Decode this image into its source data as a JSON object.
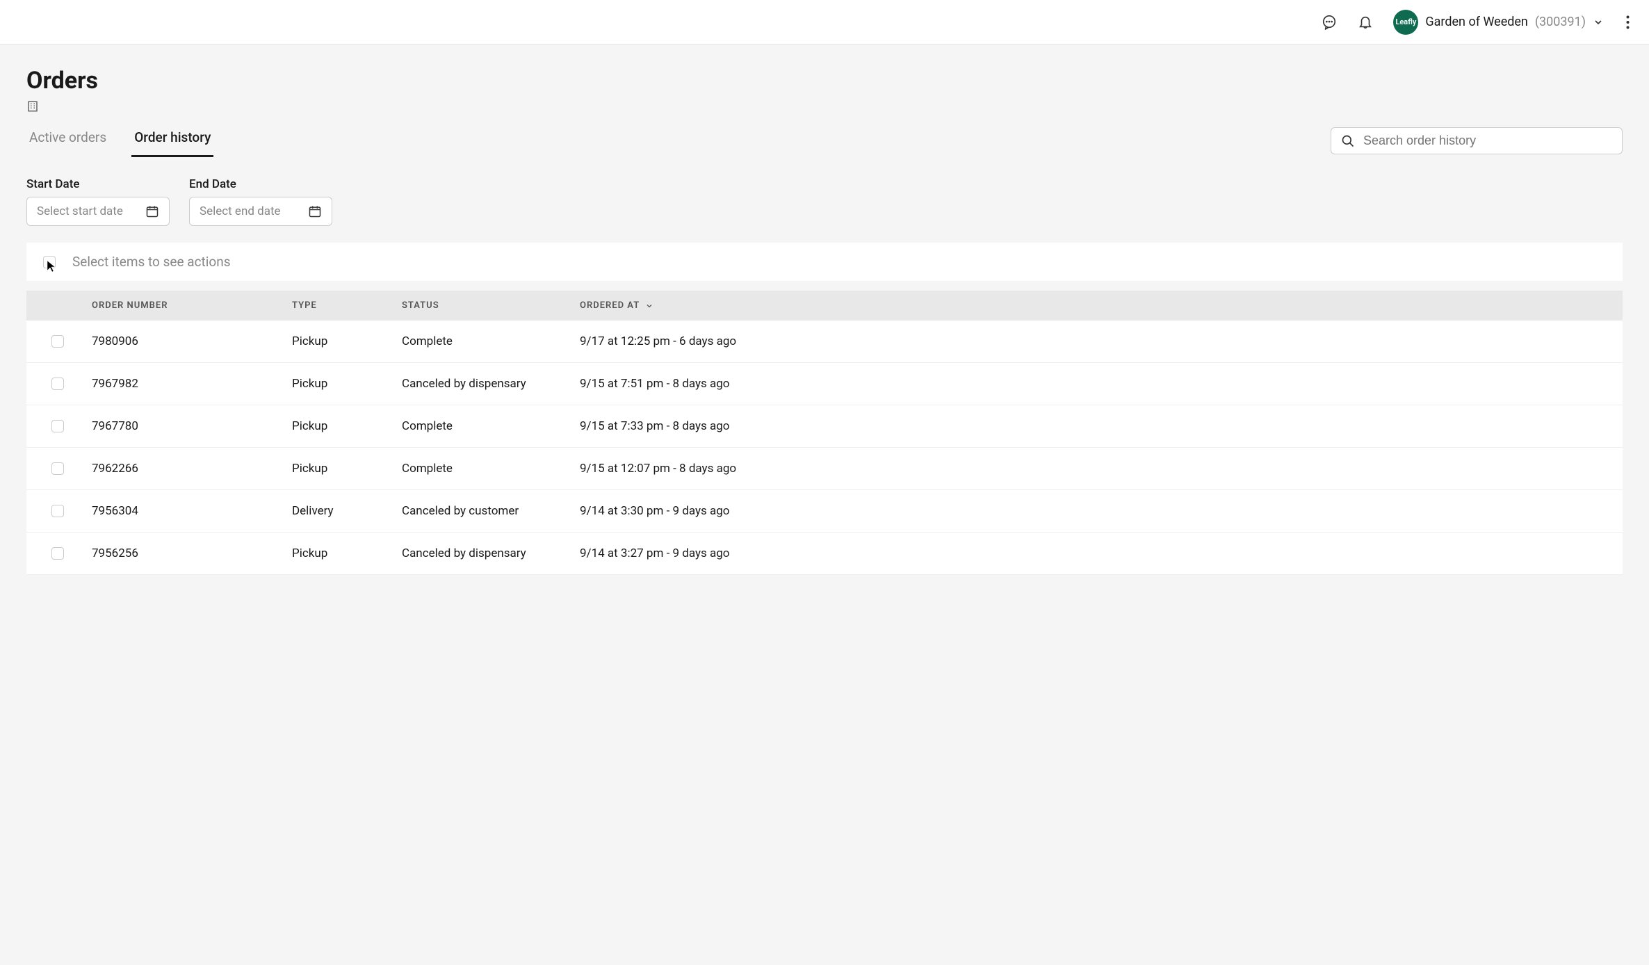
{
  "header": {
    "account_name": "Garden of Weeden",
    "account_id": "(300391)",
    "avatar_text": "Leafly"
  },
  "page": {
    "title": "Orders"
  },
  "tabs": {
    "active_orders": "Active orders",
    "order_history": "Order history"
  },
  "search": {
    "placeholder": "Search order history"
  },
  "filters": {
    "start_date_label": "Start Date",
    "start_date_placeholder": "Select start date",
    "end_date_label": "End Date",
    "end_date_placeholder": "Select end date"
  },
  "actions": {
    "hint": "Select items to see actions"
  },
  "columns": {
    "order_number": "ORDER NUMBER",
    "type": "TYPE",
    "status": "STATUS",
    "ordered_at": "ORDERED AT"
  },
  "rows": [
    {
      "order": "7980906",
      "type": "Pickup",
      "status": "Complete",
      "ordered_at": "9/17 at 12:25 pm - 6 days ago"
    },
    {
      "order": "7967982",
      "type": "Pickup",
      "status": "Canceled by dispensary",
      "ordered_at": "9/15 at 7:51 pm - 8 days ago"
    },
    {
      "order": "7967780",
      "type": "Pickup",
      "status": "Complete",
      "ordered_at": "9/15 at 7:33 pm - 8 days ago"
    },
    {
      "order": "7962266",
      "type": "Pickup",
      "status": "Complete",
      "ordered_at": "9/15 at 12:07 pm - 8 days ago"
    },
    {
      "order": "7956304",
      "type": "Delivery",
      "status": "Canceled by customer",
      "ordered_at": "9/14 at 3:30 pm - 9 days ago"
    },
    {
      "order": "7956256",
      "type": "Pickup",
      "status": "Canceled by dispensary",
      "ordered_at": "9/14 at 3:27 pm - 9 days ago"
    }
  ]
}
